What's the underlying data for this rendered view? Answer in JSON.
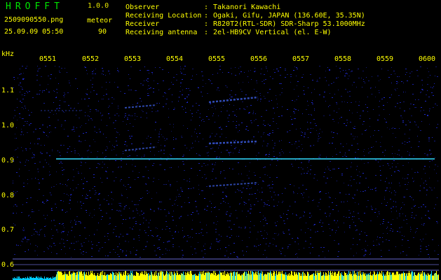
{
  "header": {
    "app_title": "HROFFT",
    "app_version": "1.0.0",
    "file_name": "2509090550.png",
    "event_type": "meteor",
    "timestamp": "25.09.09 05:50",
    "event_count": "90"
  },
  "info": [
    {
      "label": "Observer",
      "sep": ":",
      "value": "Takanori Kawachi"
    },
    {
      "label": "Receiving Location",
      "sep": ":",
      "value": "Ogaki, Gifu, JAPAN (136.60E, 35.35N)"
    },
    {
      "label": "Receiver",
      "sep": ":",
      "value": "R820T2(RTL-SDR) SDR-Sharp 53.1000MHz"
    },
    {
      "label": "Receiving antenna",
      "sep": ":",
      "value": "2el-HB9CV Vertical (el. E-W)"
    }
  ],
  "axes": {
    "y_unit": "kHz",
    "x_ticks": [
      "0551",
      "0552",
      "0553",
      "0554",
      "0555",
      "0556",
      "0557",
      "0558",
      "0559",
      "0600"
    ],
    "y_ticks": [
      "1.1",
      "1.0",
      "0.9",
      "0.8",
      "0.7",
      "0.6"
    ]
  },
  "colors": {
    "background": "#000000",
    "text": "#ffff00",
    "title": "#00e600",
    "carrier": "#33ddff",
    "noise": "#1a1aa0",
    "level_bar": "#ffff00",
    "level_bar_low": "#00ccff"
  }
}
